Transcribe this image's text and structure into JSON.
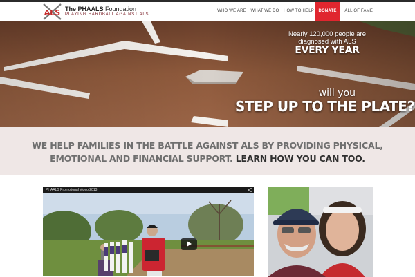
{
  "header": {
    "logo": {
      "title_bold": "The PHAALS",
      "title_rest": " Foundation",
      "tagline": "PLAYING HARDBALL AGAINST ALS",
      "mark_text": "ALS"
    },
    "nav": [
      {
        "label": "WHO WE ARE",
        "active": false
      },
      {
        "label": "WHAT WE DO",
        "active": false
      },
      {
        "label": "HOW TO HELP",
        "active": false
      },
      {
        "label": "DONATE",
        "active": true
      },
      {
        "label": "HALL OF FAME",
        "active": false
      }
    ]
  },
  "hero": {
    "stat_line1": "Nearly 120,000 people are",
    "stat_line2": "diagnosed with ALS",
    "stat_line3": "EVERY YEAR",
    "cta_small": "will you",
    "cta_big": "STEP UP TO THE PLATE?"
  },
  "mission": {
    "text_main": "WE HELP FAMILIES IN THE BATTLE AGAINST ALS BY PROVIDING PHYSICAL, EMOTIONAL AND FINANCIAL SUPPORT.",
    "text_cta": "LEARN HOW YOU CAN TOO."
  },
  "video": {
    "title": "PHAALS Promotional Video 2013",
    "share_icon": "share-icon",
    "play_icon": "play-icon"
  },
  "colors": {
    "accent": "#e0262f",
    "mission_bg": "#efe7e6",
    "dirt": "#8e5a3e"
  }
}
